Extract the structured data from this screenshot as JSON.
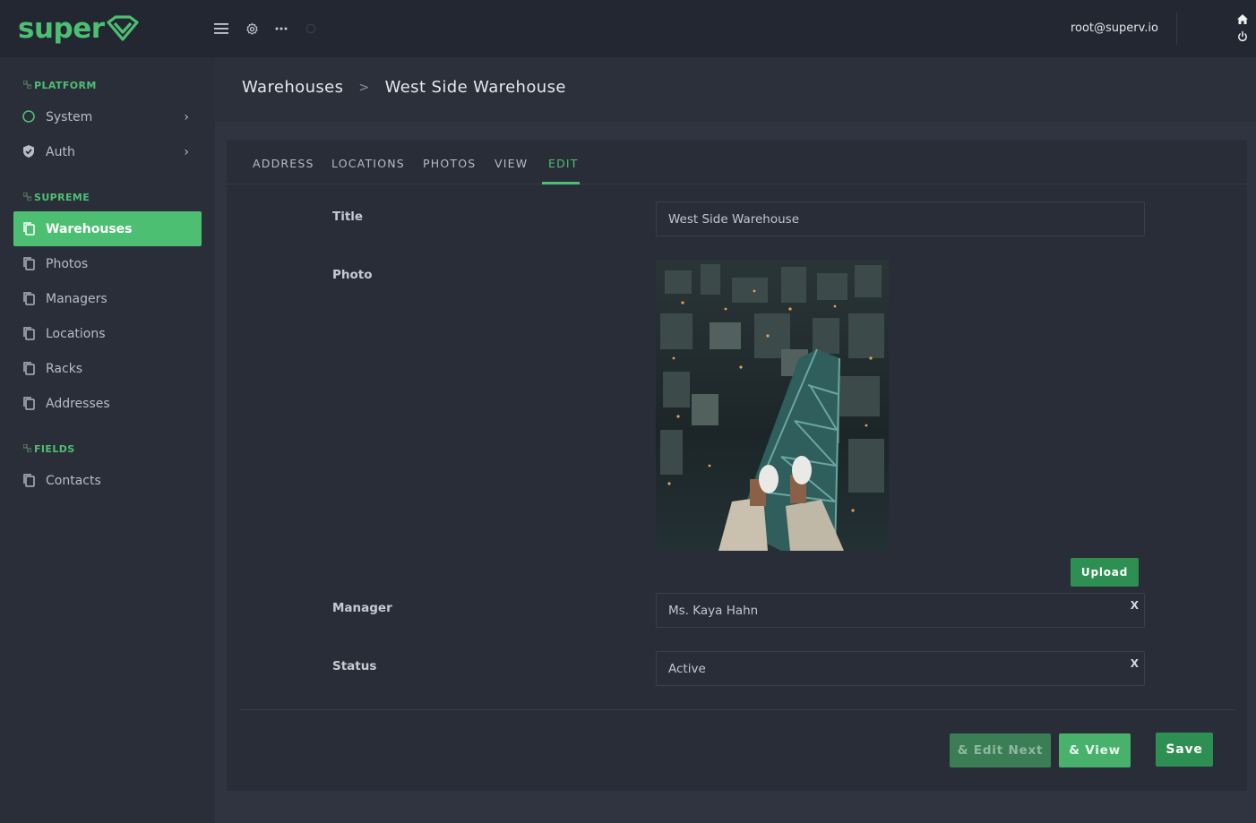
{
  "app": {
    "logo_text": "super"
  },
  "topbar": {
    "user_email": "root@superv.io"
  },
  "sidebar": {
    "sections": [
      {
        "label": "PLATFORM"
      },
      {
        "label": "SUPREME"
      },
      {
        "label": "FIELDS"
      }
    ],
    "platform_items": [
      {
        "label": "System",
        "icon": "status-circle-icon"
      },
      {
        "label": "Auth",
        "icon": "shield-check-icon"
      }
    ],
    "supreme_items": [
      {
        "label": "Warehouses",
        "icon": "copy-icon",
        "active": true
      },
      {
        "label": "Photos",
        "icon": "copy-icon"
      },
      {
        "label": "Managers",
        "icon": "copy-icon"
      },
      {
        "label": "Locations",
        "icon": "copy-icon"
      },
      {
        "label": "Racks",
        "icon": "copy-icon"
      },
      {
        "label": "Addresses",
        "icon": "copy-icon"
      }
    ],
    "fields_items": [
      {
        "label": "Contacts",
        "icon": "copy-icon"
      }
    ]
  },
  "breadcrumb": {
    "parent": "Warehouses",
    "separator": ">",
    "current": "West Side Warehouse"
  },
  "tabs": [
    {
      "label": "ADDRESS"
    },
    {
      "label": "LOCATIONS"
    },
    {
      "label": "PHOTOS"
    },
    {
      "label": "VIEW"
    },
    {
      "label": "EDIT",
      "active": true
    }
  ],
  "form": {
    "title": {
      "label": "Title",
      "value": "West Side Warehouse"
    },
    "photo": {
      "label": "Photo",
      "upload_label": "Upload"
    },
    "manager": {
      "label": "Manager",
      "value": "Ms. Kaya Hahn",
      "clear": "X"
    },
    "status": {
      "label": "Status",
      "value": "Active",
      "clear": "X"
    }
  },
  "actions": {
    "edit_next": "& Edit Next",
    "view": "& View",
    "save": "Save"
  },
  "colors": {
    "accent": "#4dbf73",
    "accent_dark": "#2e8f52",
    "topbar_bg": "#222731",
    "sidebar_bg": "#2a2e38",
    "content_bg": "#2f3440",
    "card_bg": "#292d37"
  }
}
